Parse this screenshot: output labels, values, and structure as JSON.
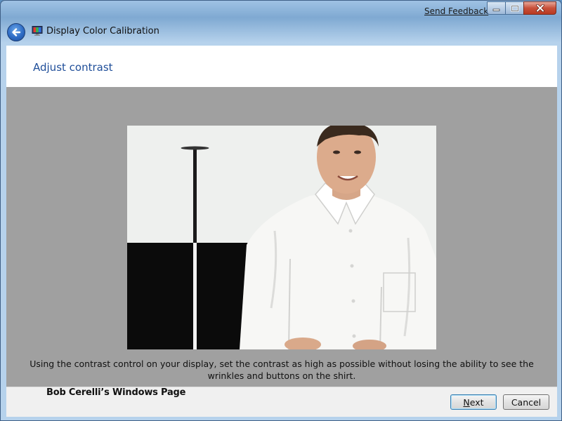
{
  "window": {
    "title": "Display Color Calibration",
    "send_feedback": "Send Feedback",
    "controls": {
      "minimize": "minimize",
      "maximize": "maximize",
      "close": "close"
    }
  },
  "page": {
    "heading": "Adjust contrast",
    "instruction": "Using the contrast control on your display, set the contrast as high as possible without losing the ability to see the wrinkles and buttons on the shirt.",
    "image_alt": "Man in white shirt against white wall and black panel"
  },
  "footer": {
    "credit": "Bob Cerelli’s Windows Page",
    "next_label": "Next",
    "cancel_label": "Cancel"
  },
  "icons": {
    "back": "back-arrow-icon",
    "app": "display-color-calibration-icon",
    "minimize": "minimize-icon",
    "maximize": "maximize-icon",
    "close": "close-icon"
  },
  "colors": {
    "heading": "#1f4e99",
    "content_bg": "#a0a0a0",
    "header_bg": "#ffffff",
    "footer_bg": "#f0f0f0"
  }
}
